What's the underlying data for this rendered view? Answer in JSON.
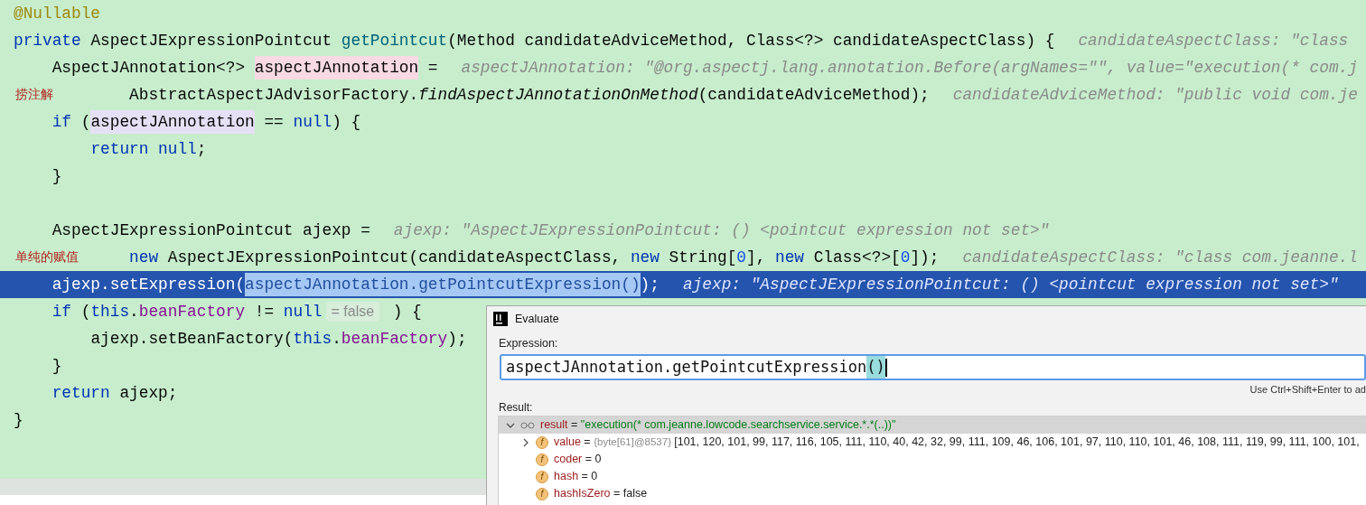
{
  "editor": {
    "lines": [
      {
        "kind": "code",
        "tokens": [
          {
            "text": "@Nullable",
            "kind": "annotation"
          }
        ]
      },
      {
        "kind": "code",
        "tokens": [
          {
            "text": "private",
            "kind": "keyword"
          },
          {
            "text": " AspectJExpressionPointcut ",
            "kind": "plain"
          },
          {
            "text": "getPointcut",
            "kind": "declaration"
          },
          {
            "text": "(Method candidateAdviceMethod, Class<?> candidateAspectClass) {",
            "kind": "plain"
          },
          {
            "text": "candidateAspectClass: \"class",
            "kind": "hint"
          }
        ]
      },
      {
        "kind": "code",
        "tokens": [
          {
            "text": "    AspectJAnnotation<?> ",
            "kind": "plain"
          },
          {
            "text": "aspectJAnnotation",
            "kind": "write-usage"
          },
          {
            "text": " =",
            "kind": "plain"
          },
          {
            "text": "aspectJAnnotation: \"@org.aspectj.lang.annotation.Before(argNames=\"\", value=\"execution(* com.j",
            "kind": "hint"
          }
        ]
      },
      {
        "kind": "code",
        "note": "捞注解",
        "tokens": [
          {
            "text": "            AbstractAspectJAdvisorFactory.",
            "kind": "plain"
          },
          {
            "text": "findAspectJAnnotationOnMethod",
            "kind": "static"
          },
          {
            "text": "(candidateAdviceMethod);",
            "kind": "plain"
          },
          {
            "text": "candidateAdviceMethod: \"public void com.je",
            "kind": "hint"
          }
        ]
      },
      {
        "kind": "code",
        "tokens": [
          {
            "text": "    if",
            "kind": "keyword"
          },
          {
            "text": " (",
            "kind": "plain"
          },
          {
            "text": "aspectJAnnotation",
            "kind": "read-usage"
          },
          {
            "text": " == ",
            "kind": "plain"
          },
          {
            "text": "null",
            "kind": "keyword"
          },
          {
            "text": ") {",
            "kind": "plain"
          }
        ]
      },
      {
        "kind": "code",
        "tokens": [
          {
            "text": "        return null",
            "kind": "keyword"
          },
          {
            "text": ";",
            "kind": "plain"
          }
        ]
      },
      {
        "kind": "code",
        "tokens": [
          {
            "text": "    }",
            "kind": "plain"
          }
        ]
      },
      {
        "kind": "code"
      },
      {
        "kind": "code",
        "tokens": [
          {
            "text": "    AspectJExpressionPointcut ajexp =",
            "kind": "plain"
          },
          {
            "text": "ajexp: \"AspectJExpressionPointcut: () <pointcut expression not set>\"",
            "kind": "hint"
          }
        ]
      },
      {
        "kind": "code",
        "note": "单纯的赋值",
        "tokens": [
          {
            "text": "            new",
            "kind": "keyword"
          },
          {
            "text": " AspectJExpressionPointcut(candidateAspectClass, ",
            "kind": "plain"
          },
          {
            "text": "new",
            "kind": "keyword"
          },
          {
            "text": " String[",
            "kind": "plain"
          },
          {
            "text": "0",
            "kind": "number"
          },
          {
            "text": "], ",
            "kind": "plain"
          },
          {
            "text": "new",
            "kind": "keyword"
          },
          {
            "text": " Class<?>[",
            "kind": "plain"
          },
          {
            "text": "0",
            "kind": "number"
          },
          {
            "text": "]);",
            "kind": "plain"
          },
          {
            "text": "candidateAspectClass: \"class com.jeanne.l",
            "kind": "hint"
          }
        ]
      },
      {
        "kind": "execution-point",
        "tokens": [
          {
            "text": "    ajexp.setExpression(",
            "kind": "plain"
          },
          {
            "text": "aspectJAnnotation.getPointcutExpression()",
            "kind": "selection"
          },
          {
            "text": ");",
            "kind": "plain"
          },
          {
            "text": "ajexp: \"AspectJExpressionPointcut: () <pointcut expression not set>\"",
            "kind": "hint"
          }
        ]
      },
      {
        "kind": "code",
        "tokens": [
          {
            "text": "    if",
            "kind": "keyword"
          },
          {
            "text": " (",
            "kind": "plain"
          },
          {
            "text": "this",
            "kind": "keyword"
          },
          {
            "text": ".",
            "kind": "plain"
          },
          {
            "text": "beanFactory",
            "kind": "field"
          },
          {
            "text": " != ",
            "kind": "plain"
          },
          {
            "text": "null",
            "kind": "keyword"
          },
          {
            "text": "= false",
            "kind": "inline-value"
          },
          {
            "text": " ) {",
            "kind": "plain"
          }
        ]
      },
      {
        "kind": "code",
        "tokens": [
          {
            "text": "        ajexp.setBeanFactory(",
            "kind": "plain"
          },
          {
            "text": "this",
            "kind": "keyword"
          },
          {
            "text": ".",
            "kind": "plain"
          },
          {
            "text": "beanFactory",
            "kind": "field"
          },
          {
            "text": ");",
            "kind": "plain"
          }
        ]
      },
      {
        "kind": "code",
        "tokens": [
          {
            "text": "    }",
            "kind": "plain"
          }
        ]
      },
      {
        "kind": "code",
        "tokens": [
          {
            "text": "    return",
            "kind": "keyword"
          },
          {
            "text": " ajexp;",
            "kind": "plain"
          }
        ]
      },
      {
        "kind": "code",
        "tokens": [
          {
            "text": "}",
            "kind": "plain"
          }
        ]
      }
    ]
  },
  "evaluate_dialog": {
    "title": "Evaluate",
    "expression_label": "Expression:",
    "expression": {
      "value": "aspectJAnnotation.getPointcutExpression",
      "brace_match": "()"
    },
    "shortcut_hint": "Use Ctrl+Shift+Enter to ad",
    "result_label": "Result:",
    "result": {
      "name": "result",
      "equals": "=",
      "value": "\"execution(* com.jeanne.lowcode.searchservice.service.*.*(..))\"",
      "expanded": true,
      "selected": true,
      "children": [
        {
          "glyph": "f",
          "name": "value",
          "equals": "=",
          "type": "{byte[61]@8537}",
          "value": "[101, 120, 101, 99, 117, 116, 105, 111, 110, 40, 42, 32, 99, 111, 109, 46, 106, 101, 97, 110, 110, 101, 46, 108, 111, 119, 99, 111, 100, 101,",
          "expanded": false
        },
        {
          "glyph": "f",
          "name": "coder",
          "equals": "=",
          "value": "0"
        },
        {
          "glyph": "f",
          "name": "hash",
          "equals": "=",
          "value": "0"
        },
        {
          "glyph": "f",
          "name": "hashIsZero",
          "equals": "=",
          "value": "false"
        }
      ]
    }
  }
}
